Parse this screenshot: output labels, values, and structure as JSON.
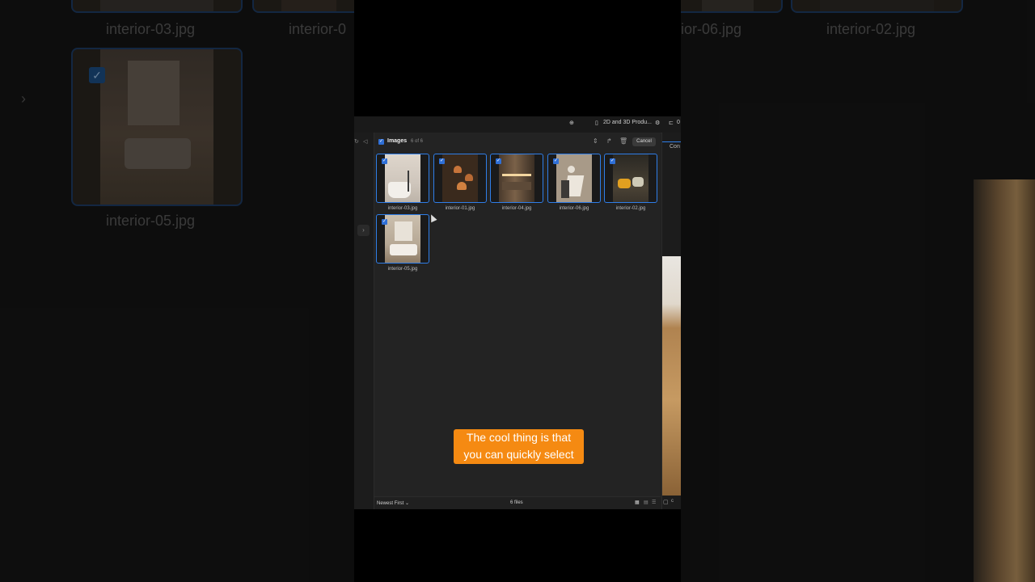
{
  "background_left": {
    "labels": [
      "interior-03.jpg",
      "interior-0",
      "interior-05.jpg"
    ]
  },
  "background_right": {
    "labels": [
      "ior-06.jpg",
      "interior-02.jpg"
    ]
  },
  "topbar": {
    "project_label": "2D and 3D Produ...",
    "edge_label": "0"
  },
  "panel": {
    "title": "Images",
    "count": "6 of 6",
    "cancel_label": "Cancel",
    "right_cut_label": "Con"
  },
  "thumbnails": [
    {
      "name": "interior-03.jpg"
    },
    {
      "name": "interior-01.jpg"
    },
    {
      "name": "interior-04.jpg"
    },
    {
      "name": "interior-06.jpg"
    },
    {
      "name": "interior-02.jpg"
    },
    {
      "name": "interior-05.jpg"
    }
  ],
  "footer": {
    "sort_label": "Newest First",
    "files_label": "6 files",
    "edge_label": "c"
  },
  "caption": {
    "line1": "The cool thing is that",
    "line2": "you can quickly select"
  },
  "icons": {
    "globe": "globe-icon",
    "file": "file-icon",
    "gear": "gear-icon",
    "folder": "folder-icon",
    "move": "move-icon",
    "share": "share-icon",
    "trash": "trash-icon",
    "check": "check-icon",
    "chevron": "chevron-right-icon"
  },
  "colors": {
    "accent": "#2f7ee8",
    "caption_bg": "#f58a12"
  }
}
